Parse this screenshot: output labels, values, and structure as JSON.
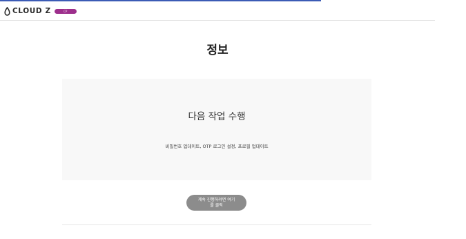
{
  "brand": {
    "logo_text": "CLOUD Z",
    "badge": "CP",
    "badge_color": "#9d2f8c",
    "icon": "cloud-drop-icon"
  },
  "page": {
    "title": "정보"
  },
  "panel": {
    "heading": "다음 작업 수행",
    "description": "비밀번호 업데이트, OTP 로그인 설정, 프로필 업데이트"
  },
  "actions": {
    "continue_label": "계속 진행하려면 여기\n를 클릭"
  },
  "colors": {
    "accent": "#3b5bb5",
    "button": "#8c8c8c",
    "panel_bg": "#f8f8f8"
  }
}
